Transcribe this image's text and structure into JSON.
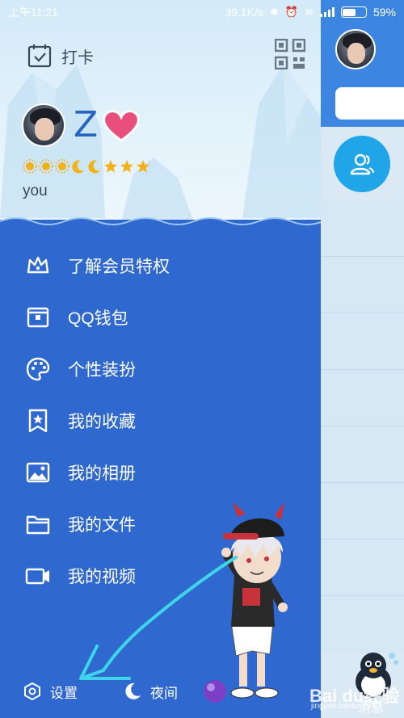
{
  "status_bar": {
    "time": "上午11:21",
    "network_speed": "39.1K/s",
    "battery_percent": "59%",
    "battery_level": 0.59,
    "icons": [
      "bluetooth-icon",
      "alarm-icon",
      "wifi-icon",
      "signal-icon",
      "battery-icon"
    ]
  },
  "drawer": {
    "checkin_label": "打卡",
    "profile": {
      "nickname": "Z",
      "signature": "you",
      "level_icons": [
        "sun",
        "sun",
        "sun",
        "moon",
        "moon",
        "star",
        "star",
        "star"
      ]
    },
    "menu": [
      {
        "label": "了解会员特权",
        "icon": "crown-icon"
      },
      {
        "label": "QQ钱包",
        "icon": "wallet-icon"
      },
      {
        "label": "个性装扮",
        "icon": "palette-icon"
      },
      {
        "label": "我的收藏",
        "icon": "favorites-icon"
      },
      {
        "label": "我的相册",
        "icon": "album-icon"
      },
      {
        "label": "我的文件",
        "icon": "folder-icon"
      },
      {
        "label": "我的视频",
        "icon": "video-icon"
      }
    ],
    "bottom": {
      "settings_label": "设置",
      "night_label": "夜间"
    }
  },
  "main_panel": {
    "tab_messages": "消息"
  },
  "watermark": {
    "brand": "Bai du经验",
    "url": "jingyan.baidu.com"
  },
  "colors": {
    "drawer_blue": "#2f68cf",
    "header_light": "#d3eaf8",
    "accent_cyan": "#1fa5e8",
    "nickname_blue": "#2764be",
    "annotation_cyan": "#3fd5e8"
  }
}
